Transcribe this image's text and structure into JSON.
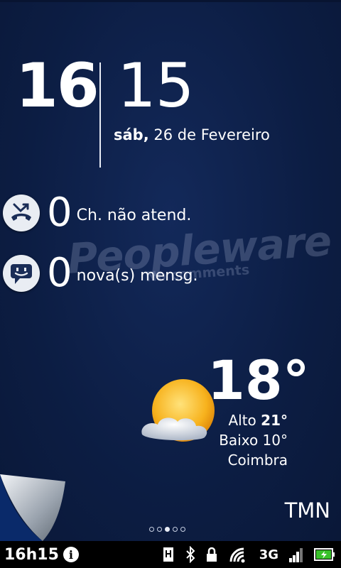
{
  "clock": {
    "hour": "16",
    "minute": "15",
    "weekday": "sáb,",
    "date": "26 de Fevereiro"
  },
  "notifications": {
    "missed_calls": {
      "count": "0",
      "label": "Ch. não atend."
    },
    "messages": {
      "count": "0",
      "label": "nova(s) mensg."
    }
  },
  "watermark": {
    "title": "Peopleware",
    "subtitle": "No comments"
  },
  "weather": {
    "temperature": "18°",
    "high_label": "Alto",
    "high_value": "21°",
    "low_label": "Baixo",
    "low_value": "10°",
    "city": "Coimbra",
    "icon": "sun-cloud-icon"
  },
  "carrier": "TMN",
  "home_pages": {
    "count": 5,
    "active_index": 2
  },
  "statusbar": {
    "time": "16h15",
    "network": "3G",
    "icons": [
      "info-icon",
      "usb-debug-icon",
      "bluetooth-icon",
      "lock-icon",
      "wifi-icon",
      "signal-icon",
      "battery-charging-icon"
    ]
  },
  "colors": {
    "background": "#0c1d43",
    "text": "#ffffff",
    "badge": "#e9edf3",
    "statusbar": "#000000",
    "battery": "#39c12a"
  }
}
